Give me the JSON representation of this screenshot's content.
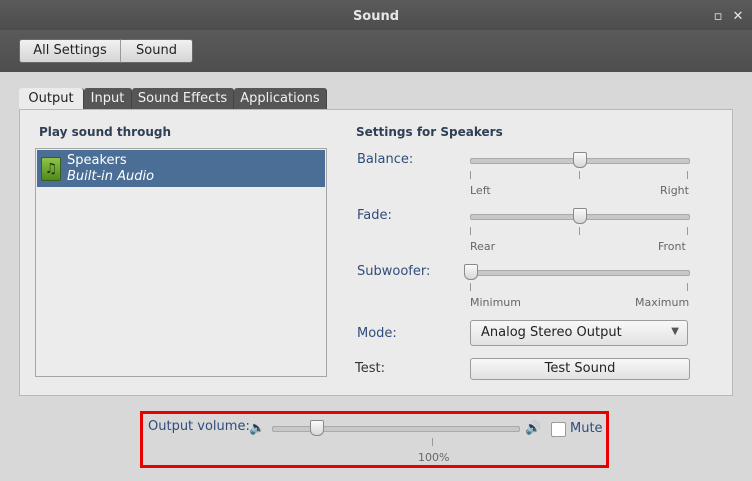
{
  "window": {
    "title": "Sound"
  },
  "toolbar": {
    "all_settings": "All Settings",
    "sound": "Sound"
  },
  "tabs": [
    {
      "label": "Output",
      "active": true
    },
    {
      "label": "Input",
      "active": false
    },
    {
      "label": "Sound Effects",
      "active": false
    },
    {
      "label": "Applications",
      "active": false
    }
  ],
  "output": {
    "heading": "Play sound through",
    "devices": [
      {
        "name": "Speakers",
        "subtitle": "Built-in Audio",
        "icon": "music-note-icon",
        "selected": true
      }
    ]
  },
  "settings": {
    "heading": "Settings for Speakers",
    "balance": {
      "label": "Balance:",
      "min_label": "Left",
      "max_label": "Right",
      "value": 0.5
    },
    "fade": {
      "label": "Fade:",
      "min_label": "Rear",
      "max_label": "Front",
      "value": 0.5
    },
    "subwoofer": {
      "label": "Subwoofer:",
      "min_label": "Minimum",
      "max_label": "Maximum",
      "value": 0.0
    },
    "mode": {
      "label": "Mode:",
      "value": "Analog Stereo Output"
    },
    "test": {
      "label": "Test:",
      "button": "Test Sound"
    }
  },
  "volume": {
    "label": "Output volume:",
    "percent_label": "100%",
    "value": 0.18,
    "mute_label": "Mute",
    "muted": false
  },
  "colors": {
    "selection": "#4a6e96",
    "highlight_box": "#e80000"
  }
}
